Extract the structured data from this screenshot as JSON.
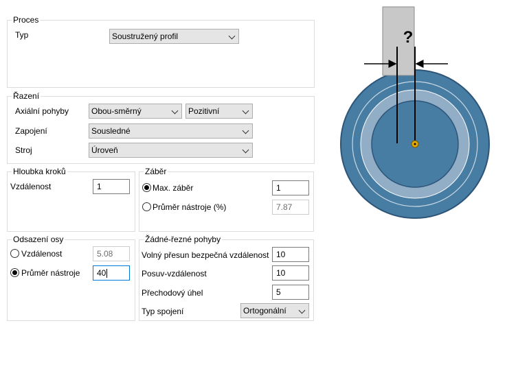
{
  "proces": {
    "title": "Proces",
    "typ_label": "Typ",
    "typ_value": "Soustružený profil"
  },
  "razeni": {
    "title": "Řazení",
    "axialni_label": "Axiální pohyby",
    "axialni_value": "Obou-směrný",
    "smer_value": "Pozitivní",
    "zapojeni_label": "Zapojení",
    "zapojeni_value": "Sousledné",
    "stroj_label": "Stroj",
    "stroj_value": "Úroveň"
  },
  "hloubka": {
    "title": "Hloubka kroků",
    "vzdalenost_label": "Vzdálenost",
    "vzdalenost_value": "1"
  },
  "zaber": {
    "title": "Záběr",
    "max_label": "Max. záběr",
    "max_value": "1",
    "max_selected": true,
    "prumer_label": "Průměr nástroje  (%)",
    "prumer_value": "7.87",
    "prumer_selected": false
  },
  "odsazeni": {
    "title": "Odsazení osy",
    "vzdalenost_label": "Vzdálenost",
    "vzdalenost_value": "5.08",
    "vzdalenost_selected": false,
    "prumer_label": "Průměr nástroje  (%",
    "prumer_value": "40",
    "prumer_selected": true
  },
  "zadne": {
    "title": "Žádné-řezné pohyby",
    "volny_label": "Volný přesun bezpečná vzdálenost",
    "volny_value": "10",
    "posuv_label": "Posuv-vzdálenost",
    "posuv_value": "10",
    "prechodovy_label": "Přechodový úhel",
    "prechodovy_value": "5",
    "typ_spojeni_label": "Typ spojení",
    "typ_spojeni_value": "Ortogonální"
  },
  "illustration": {
    "question_mark": "?",
    "colors": {
      "disc": "#477ca3",
      "disc_border": "#2e5578",
      "ring": "#92adc6",
      "tool": "#c8c8c8",
      "center": "#e0a800"
    }
  }
}
